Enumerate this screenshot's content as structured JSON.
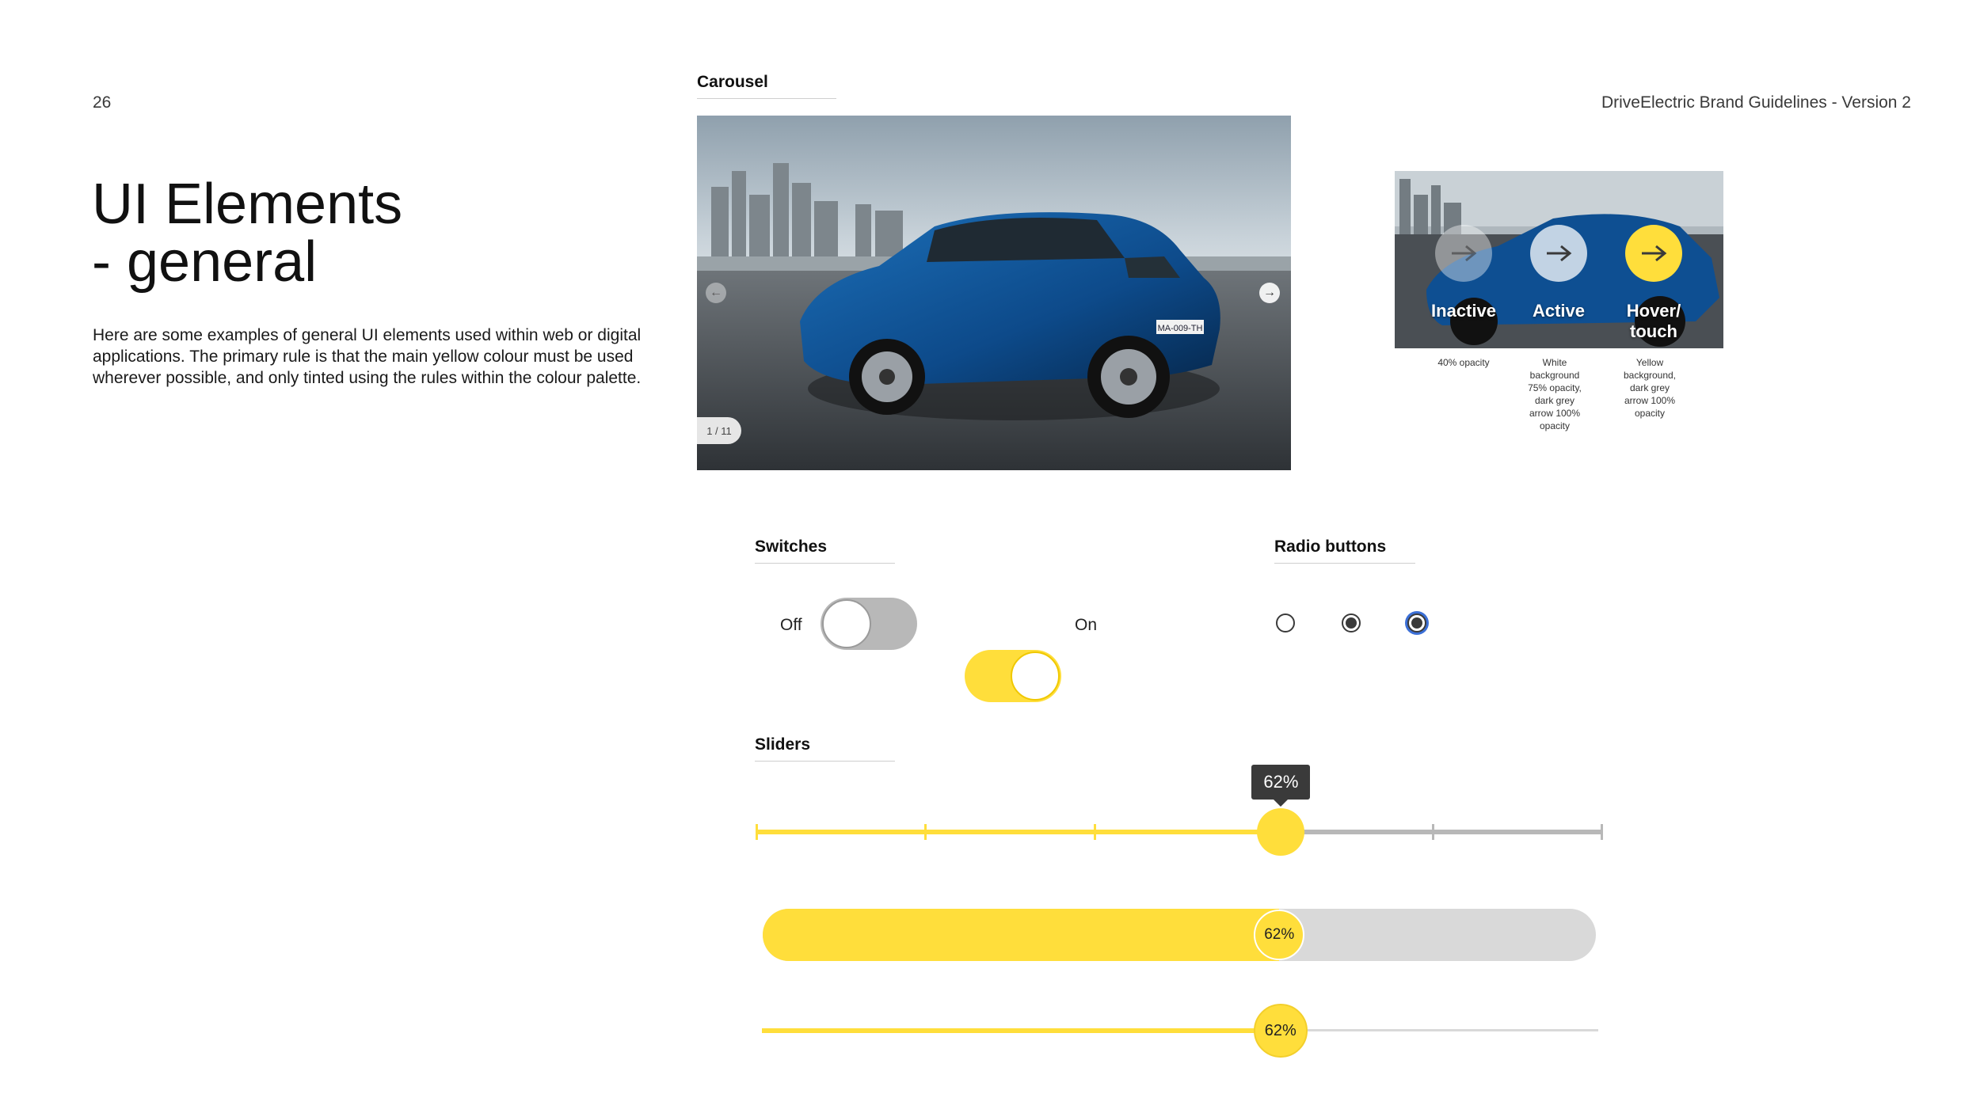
{
  "page": {
    "number": "26",
    "doc_title": "DriveElectric Brand Guidelines - Version 2",
    "heading": "UI Elements\n- general",
    "intro": "Here are some examples of general UI elements used within web or digital applications. The primary rule is that the main yellow colour must be used wherever possible, and only tinted using the rules within the colour palette."
  },
  "carousel": {
    "label": "Carousel",
    "pager": "1 / 11",
    "prev_icon": "arrow-left-icon",
    "next_icon": "arrow-right-icon",
    "plate": "MA-009-TH",
    "states": [
      {
        "label": "Inactive",
        "note": "40% opacity",
        "icon": "arrow-right-icon"
      },
      {
        "label": "Active",
        "note": "White background 75% opacity, dark grey arrow 100% opacity",
        "icon": "arrow-right-icon"
      },
      {
        "label": "Hover/ touch",
        "note": "Yellow background, dark grey arrow 100% opacity",
        "icon": "arrow-right-icon"
      }
    ]
  },
  "switches": {
    "label": "Switches",
    "off_label": "Off",
    "on_label": "On",
    "off_state": false,
    "on_state": true
  },
  "radios": {
    "label": "Radio buttons",
    "items": [
      {
        "state": "unselected"
      },
      {
        "state": "selected"
      },
      {
        "state": "selected-focused"
      }
    ]
  },
  "sliders": {
    "label": "Sliders",
    "value": 0.62,
    "value_label": "62%",
    "stepped_ticks": 6
  },
  "colors": {
    "yellow": "#FFDE3B",
    "grey_track": "#B8B8B8",
    "light_track": "#D9D9D9",
    "dark": "#3A3A3A",
    "focus_blue": "#3B6FD6"
  }
}
